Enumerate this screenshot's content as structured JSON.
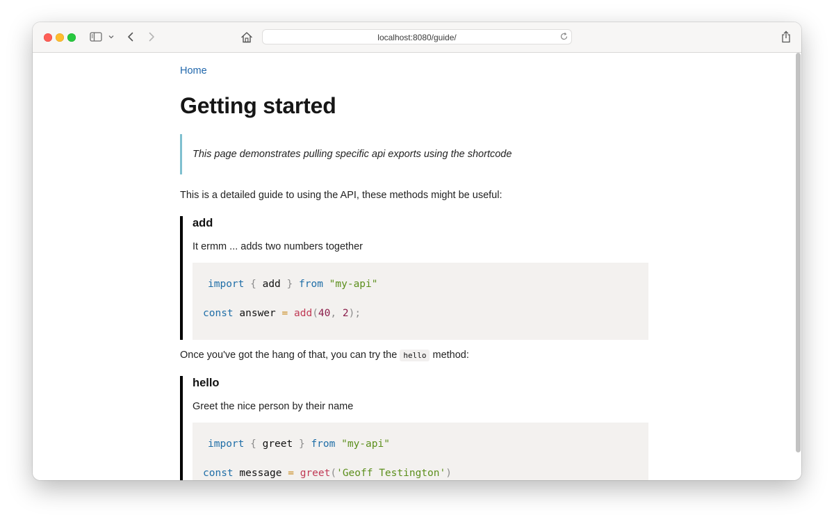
{
  "browser": {
    "url": "localhost:8080/guide/",
    "icons": {
      "sidebar": "sidebar-icon",
      "chevron": "chevron-down-icon",
      "back": "back-icon",
      "forward": "forward-icon",
      "home": "home-icon",
      "reload": "reload-icon",
      "share": "share-icon"
    }
  },
  "page": {
    "breadcrumb": "Home",
    "title": "Getting started",
    "callout": "This page demonstrates pulling specific api exports using the shortcode",
    "intro": "This is a detailed guide to using the API, these methods might be useful:",
    "transition_before": "Once you've got the hang of that, you can try the",
    "transition_code": "hello",
    "transition_after": "method:",
    "methods": [
      {
        "name": "add",
        "description": "It ermm ... adds two numbers together",
        "code": {
          "l1_kw": "import",
          "l1_open": "{",
          "l1_ident": "add",
          "l1_close": "}",
          "l1_from": "from",
          "l1_str": "\"my-api\"",
          "l2_kw": "const",
          "l2_ident": "answer",
          "l2_op": "=",
          "l2_fn": "add",
          "l2_paren_open": "(",
          "l2_arg1": "40",
          "l2_comma": ",",
          "l2_arg2": "2",
          "l2_close": ");"
        }
      },
      {
        "name": "hello",
        "description": "Greet the nice person by their name",
        "code": {
          "l1_kw": "import",
          "l1_open": "{",
          "l1_ident": "greet",
          "l1_close": "}",
          "l1_from": "from",
          "l1_str": "\"my-api\"",
          "l2_kw": "const",
          "l2_ident": "message",
          "l2_op": "=",
          "l2_fn": "greet",
          "l2_paren_open": "(",
          "l2_arg": "'Geoff Testington'",
          "l2_close": ")"
        }
      }
    ]
  }
}
